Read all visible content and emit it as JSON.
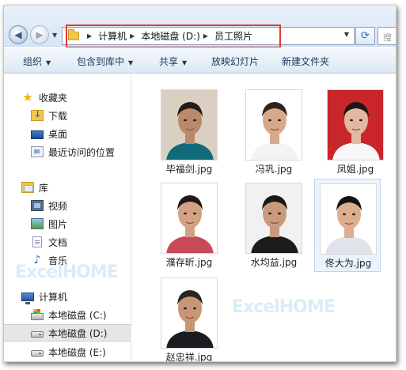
{
  "window": {
    "address": {
      "crumbs": [
        "计算机",
        "本地磁盘 (D:)",
        "员工照片"
      ],
      "search_placeholder": "搜"
    },
    "toolbar": {
      "organize": "组织",
      "include_library": "包含到库中",
      "share": "共享",
      "slideshow": "放映幻灯片",
      "new_folder": "新建文件夹"
    },
    "nav": {
      "favorites": "收藏夹",
      "downloads": "下载",
      "desktop": "桌面",
      "recent": "最近访问的位置",
      "libraries": "库",
      "videos": "视频",
      "pictures": "图片",
      "documents": "文档",
      "music": "音乐",
      "computer": "计算机",
      "drive_c": "本地磁盘 (C:)",
      "drive_d": "本地磁盘 (D:)",
      "drive_e": "本地磁盘 (E:)"
    },
    "files": [
      {
        "name": "毕福剑.jpg",
        "bg": "#d9d0c2",
        "hair": "#241c16",
        "skin": "#b98a6a",
        "shirt": "#0f6a7a"
      },
      {
        "name": "冯巩.jpg",
        "bg": "#ffffff",
        "hair": "#2a2420",
        "skin": "#d7a889",
        "shirt": "#f3f3f3"
      },
      {
        "name": "凤姐.jpg",
        "bg": "#c8262b",
        "hair": "#1c1614",
        "skin": "#e1b8a0",
        "shirt": "#f7f7f7"
      },
      {
        "name": "濮存昕.jpg",
        "bg": "#ffffff",
        "hair": "#1f1a17",
        "skin": "#d2a283",
        "shirt": "#c74a5a"
      },
      {
        "name": "水均益.jpg",
        "bg": "#f1f1f1",
        "hair": "#1b1715",
        "skin": "#c99b7c",
        "shirt": "#1c1c1c"
      },
      {
        "name": "佟大为.jpg",
        "bg": "#ffffff",
        "hair": "#141210",
        "skin": "#dcae8e",
        "shirt": "#dfe3ea"
      },
      {
        "name": "赵忠祥.jpg",
        "bg": "#ffffff",
        "hair": "#2a2422",
        "skin": "#c89676",
        "shirt": "#1b1b22"
      }
    ],
    "watermark": "ExcelHOME"
  }
}
